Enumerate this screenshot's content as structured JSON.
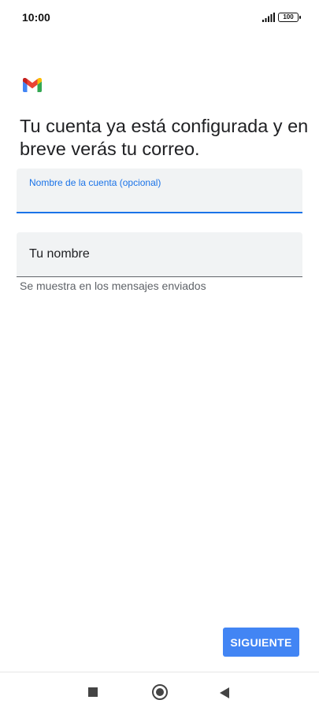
{
  "status_bar": {
    "time": "10:00",
    "battery": "100",
    "signal_icon": "signal-bars-icon"
  },
  "logo": {
    "icon": "gmail-icon",
    "colors": {
      "red": "#EA4335",
      "blue": "#4285F4",
      "green": "#34A853",
      "yellow": "#FBBC04"
    }
  },
  "header": {
    "title": "Tu cuenta ya está configurada y en breve verás tu correo."
  },
  "form": {
    "account_name": {
      "label": "Nombre de la cuenta (opcional)",
      "value": ""
    },
    "your_name": {
      "placeholder": "Tu nombre",
      "value": "",
      "helper": "Se muestra en los mensajes enviados"
    }
  },
  "actions": {
    "next_label": "SIGUIENTE"
  },
  "nav": {
    "recents_icon": "square-icon",
    "home_icon": "circle-icon",
    "back_icon": "back-triangle-icon"
  },
  "colors": {
    "accent": "#1a73e8",
    "button": "#4285f4",
    "field_bg": "#f1f3f4"
  }
}
